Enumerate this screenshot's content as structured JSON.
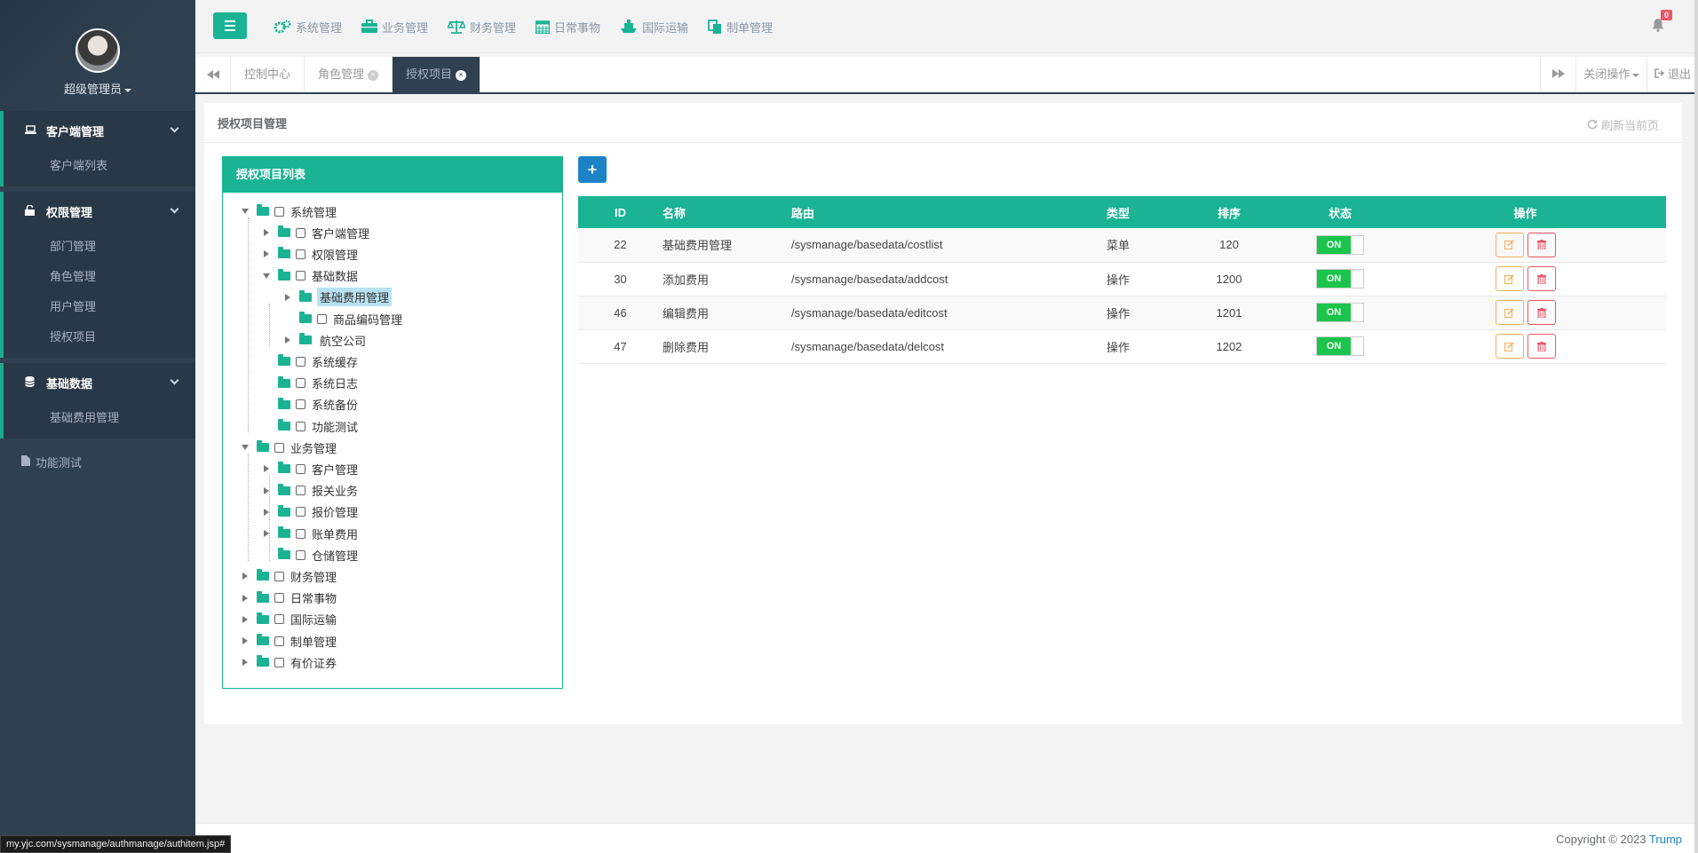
{
  "profile": {
    "name": "超级管理员"
  },
  "sidebar": {
    "groups": [
      {
        "label": "客户端管理",
        "icon": "laptop-icon",
        "items": [
          "客户端列表"
        ]
      },
      {
        "label": "权限管理",
        "icon": "unlock-icon",
        "items": [
          "部门管理",
          "角色管理",
          "用户管理",
          "授权项目"
        ]
      },
      {
        "label": "基础数据",
        "icon": "database-icon",
        "items": [
          "基础费用管理"
        ]
      }
    ],
    "plain_item": "功能测试"
  },
  "topnav": [
    "系统管理",
    "业务管理",
    "财务管理",
    "日常事物",
    "国际运输",
    "制单管理"
  ],
  "notifications": {
    "count": "0"
  },
  "tabs": [
    {
      "label": "控制中心"
    },
    {
      "label": "角色管理"
    },
    {
      "label": "授权项目"
    }
  ],
  "tab_actions": {
    "close_ops": "关闭操作",
    "logout": "退出"
  },
  "panel": {
    "title": "授权项目管理",
    "refresh": "刷新当前页"
  },
  "tree": {
    "title": "授权项目列表",
    "nodes": [
      "系统管理",
      "客户端管理",
      "权限管理",
      "基础数据",
      "基础费用管理",
      "商品编码管理",
      "航空公司",
      "系统缓存",
      "系统日志",
      "系统备份",
      "功能测试",
      "业务管理",
      "客户管理",
      "报关业务",
      "报价管理",
      "账单费用",
      "仓储管理",
      "财务管理",
      "日常事物",
      "国际运输",
      "制单管理",
      "有价证券"
    ]
  },
  "table": {
    "columns": [
      "ID",
      "名称",
      "路由",
      "类型",
      "排序",
      "状态",
      "操作"
    ],
    "rows": [
      {
        "id": "22",
        "name": "基础费用管理",
        "route": "/sysmanage/basedata/costlist",
        "type": "菜单",
        "order": "120",
        "status": "ON"
      },
      {
        "id": "30",
        "name": "添加费用",
        "route": "/sysmanage/basedata/addcost",
        "type": "操作",
        "order": "1200",
        "status": "ON"
      },
      {
        "id": "46",
        "name": "编辑费用",
        "route": "/sysmanage/basedata/editcost",
        "type": "操作",
        "order": "1201",
        "status": "ON"
      },
      {
        "id": "47",
        "name": "删除费用",
        "route": "/sysmanage/basedata/delcost",
        "type": "操作",
        "order": "1202",
        "status": "ON"
      }
    ]
  },
  "footer": {
    "copyright": "Copyright © 2023",
    "author": "Trump"
  },
  "status_url": "my.yjc.com/sysmanage/authmanage/authitem.jsp#",
  "colors": {
    "accent": "#1ab394",
    "sidebar": "#2f4050",
    "primary": "#1c84c6",
    "danger": "#ed5565",
    "warning": "#f8ac59"
  }
}
